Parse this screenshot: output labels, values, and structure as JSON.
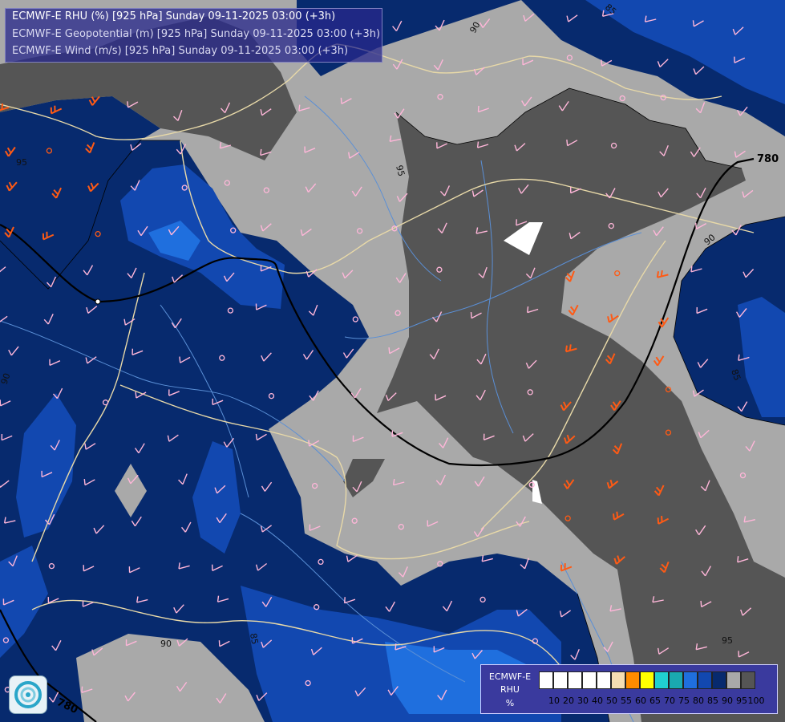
{
  "title_lines": [
    "ECMWF-E RHU (%) [925 hPa] Sunday 09-11-2025 03:00 (+3h)",
    "ECMWF-E Geopotential (m) [925 hPa] Sunday 09-11-2025 03:00 (+3h)",
    "ECMWF-E Wind (m/s) [925 hPa] Sunday 09-11-2025 03:00 (+3h)"
  ],
  "legend": {
    "title_lines": [
      "ECMWF-E",
      "RHU",
      "%"
    ],
    "colors": [
      "#ffffff",
      "#ffffff",
      "#ffffff",
      "#ffffff",
      "#ffffff",
      "#f5deb3",
      "#ff8c00",
      "#ffff00",
      "#20d0d0",
      "#1aa9b0",
      "#1f6fde",
      "#1248b0",
      "#072a6e",
      "#a9a9a9",
      "#555555"
    ],
    "ticks": [
      "10",
      "20",
      "30",
      "40",
      "50",
      "55",
      "60",
      "65",
      "70",
      "75",
      "80",
      "85",
      "90",
      "95",
      "100"
    ]
  },
  "contour_labels": {
    "rh": [
      "95",
      "95",
      "95",
      "90",
      "85",
      "85",
      "90",
      "85",
      "95",
      "90",
      "90",
      "90",
      "85"
    ],
    "geopotential": [
      "780",
      "780"
    ]
  },
  "colors": {
    "dark_blue": "#072a6e",
    "mid_blue": "#1248b0",
    "blue": "#1f6fde",
    "gray": "#a9a9a9",
    "dark_gray": "#555555",
    "border": "#e8d9a8",
    "river": "#5a8fd6",
    "wind_barb_pink": "#ffb6d9",
    "wind_barb_orange": "#ff5a14"
  }
}
